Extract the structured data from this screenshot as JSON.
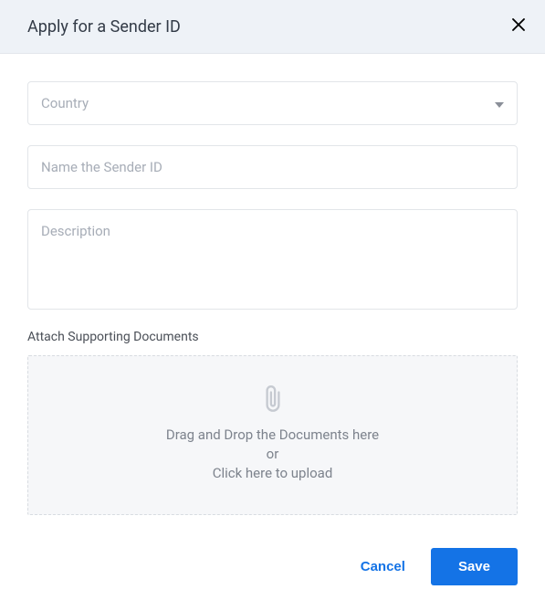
{
  "header": {
    "title": "Apply for a Sender ID"
  },
  "form": {
    "country": {
      "placeholder": "Country",
      "value": ""
    },
    "name": {
      "placeholder": "Name the Sender ID",
      "value": ""
    },
    "description": {
      "placeholder": "Description",
      "value": ""
    },
    "attach": {
      "section_label": "Attach Supporting Documents",
      "line1": "Drag and Drop the Documents here",
      "line2": "or",
      "line3": "Click here to upload"
    }
  },
  "footer": {
    "cancel": "Cancel",
    "save": "Save"
  }
}
